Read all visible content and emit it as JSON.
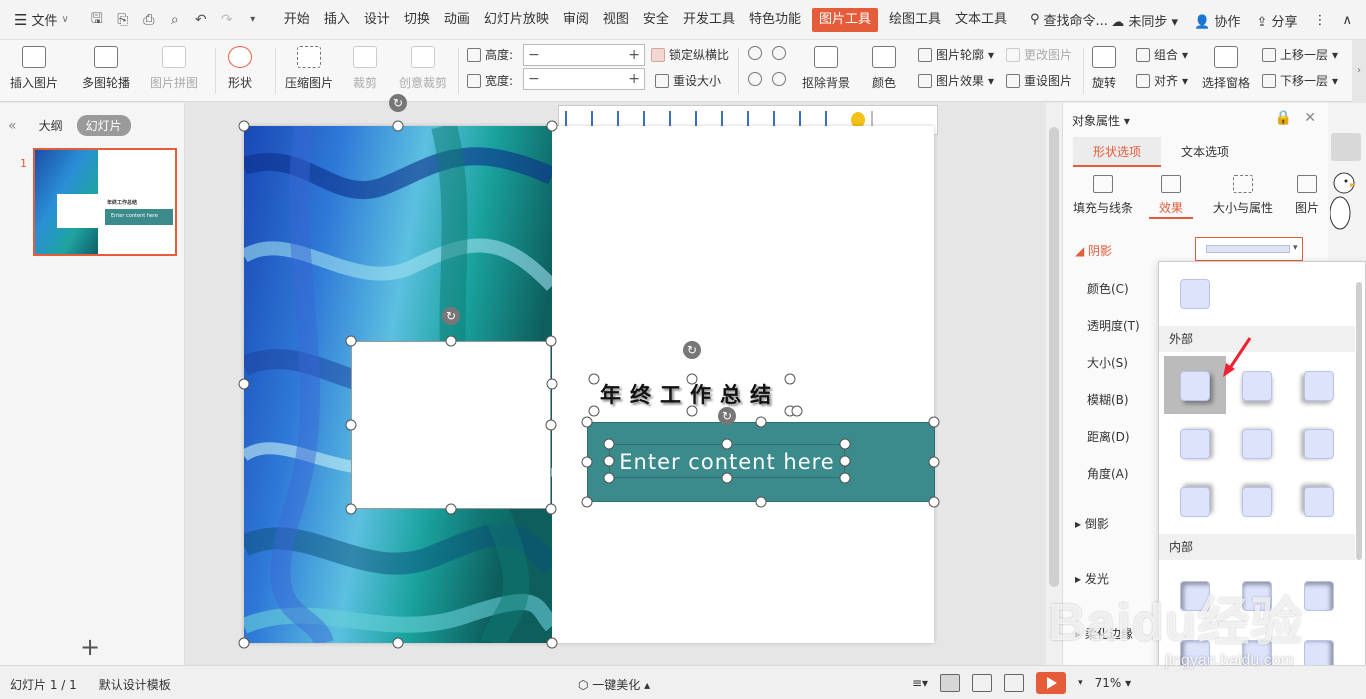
{
  "menubar": {
    "file_label": "文件",
    "tabs": [
      "开始",
      "插入",
      "设计",
      "切换",
      "动画",
      "幻灯片放映",
      "审阅",
      "视图",
      "安全",
      "开发工具",
      "特色功能",
      "图片工具",
      "绘图工具",
      "文本工具"
    ],
    "active_tab": "图片工具",
    "search_label": "查找命令...",
    "sync_label": "未同步",
    "collab_label": "协作",
    "share_label": "分享"
  },
  "ribbon": {
    "insert_picture": "插入图片",
    "multi_outline": "多图轮播",
    "picture_collage": "图片拼图",
    "shape": "形状",
    "compress": "压缩图片",
    "crop": "裁剪",
    "creative_crop": "创意裁剪",
    "height_label": "高度:",
    "width_label": "宽度:",
    "lock_ratio": "锁定纵横比",
    "reset_size": "重设大小",
    "remove_bg": "抠除背景",
    "color": "颜色",
    "picture_outline": "图片轮廓",
    "picture_effect": "图片效果",
    "change_picture": "更改图片",
    "reset_picture": "重设图片",
    "rotate": "旋转",
    "group": "组合",
    "align": "对齐",
    "selection_pane": "选择窗格",
    "bring_forward": "上移一层",
    "send_backward": "下移一层"
  },
  "leftpanel": {
    "outline_tab": "大纲",
    "slides_tab": "幻灯片",
    "slide_number": "1",
    "thumb_title": "年终工作总结",
    "thumb_content": "Enter content here"
  },
  "slide": {
    "title": "年终工作总结",
    "content": "Enter content here"
  },
  "rightpanel": {
    "title": "对象属性",
    "tab_shape": "形状选项",
    "tab_text": "文本选项",
    "sub_fill": "填充与线条",
    "sub_effect": "效果",
    "sub_size": "大小与属性",
    "sub_picture": "图片",
    "section_shadow": "阴影",
    "props": [
      "颜色(C)",
      "透明度(T)",
      "大小(S)",
      "模糊(B)",
      "距离(D)",
      "角度(A)"
    ],
    "section_reflection": "倒影",
    "section_glow": "发光",
    "section_soft": "柔化边缘"
  },
  "dropdown": {
    "outer_label": "外部",
    "inner_label": "内部"
  },
  "statusbar": {
    "slide_count": "幻灯片 1 / 1",
    "template": "默认设计模板",
    "beautify": "一键美化",
    "zoom": "71%"
  },
  "watermark": {
    "brand": "Baidu经验",
    "url": "jingyan.baidu.com"
  },
  "colors": {
    "accent": "#e45c3a",
    "teal": "#3b8a8c"
  }
}
